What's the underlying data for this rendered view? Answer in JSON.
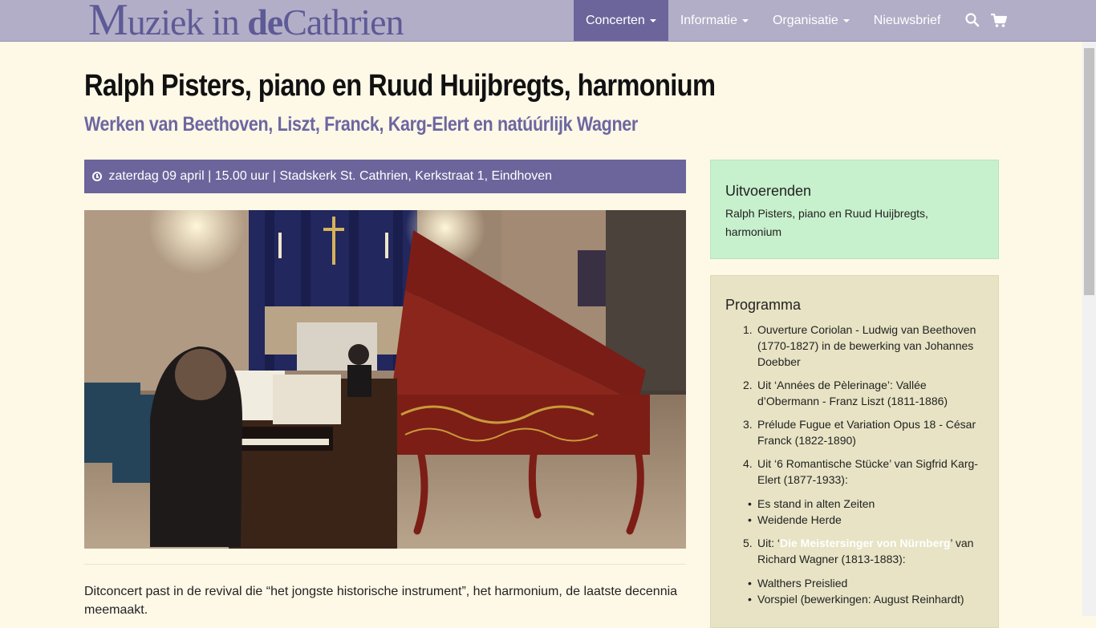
{
  "navbar": {
    "logo": {
      "part1": "M",
      "part2": "uziek ",
      "part3": "in ",
      "part4": "de",
      "part5": "Cathrien"
    },
    "items": [
      {
        "label": "Concerten",
        "has_caret": true,
        "active": true
      },
      {
        "label": "Informatie",
        "has_caret": true,
        "active": false
      },
      {
        "label": "Organisatie",
        "has_caret": true,
        "active": false
      },
      {
        "label": "Nieuwsbrief",
        "has_caret": false,
        "active": false
      }
    ],
    "icons": [
      "search-icon",
      "cart-icon"
    ]
  },
  "page": {
    "title": "Ralph Pisters, piano en Ruud Huijbregts, harmonium",
    "subtitle": "Werken van Beethoven, Liszt, Franck, Karg-Elert en natúúrlijk Wagner",
    "date_line": "zaterdag 09 april | 15.00 uur | Stadskerk St. Cathrien, Kerkstraat 1, Eindhoven",
    "intro": "Ditconcert past in de revival die “het jongste historische instrument”, het harmonium, de laatste decennia meemaakt."
  },
  "sidebar": {
    "performers": {
      "title": "Uitvoerenden",
      "text": "Ralph Pisters, piano en Ruud Huijbregts, harmonium"
    },
    "program": {
      "title": "Programma",
      "items": [
        {
          "marker": "1.",
          "text": "Ouverture Coriolan - Ludwig van Beethoven (1770-1827) in de bewerking van Johannes Doebber"
        },
        {
          "marker": "2.",
          "text": "Uit ‘Années de Pèlerinage’: Vallée d’Obermann - Franz Liszt (1811-1886)"
        },
        {
          "marker": "3.",
          "text": "Prélude Fugue et Variation Opus 18 - César Franck (1822-1890)"
        },
        {
          "marker": "4.",
          "text": "Uit ‘6 Romantische Stücke’ van Sigfrid Karg-Elert (1877-1933):"
        },
        {
          "marker": "•",
          "text": "Es stand in alten Zeiten"
        },
        {
          "marker": "•",
          "text": "Weidende Herde"
        },
        {
          "marker": "5.",
          "text_before": "Uit: ‘",
          "link": "Die Meistersinger von Nürnberg",
          "text_after": "’ van Richard Wagner (1813-1883):"
        },
        {
          "marker": "•",
          "text": "Walthers Preislied"
        },
        {
          "marker": "•",
          "text": "Vorspiel (bewerkingen: August Reinhardt)"
        }
      ]
    }
  },
  "colors": {
    "navbar_bg": "#b2aec7",
    "accent_purple": "#6b659b",
    "page_bg": "#fef8e7",
    "performers_bg": "#c7f0cc",
    "program_bg": "#e7e3c4"
  }
}
